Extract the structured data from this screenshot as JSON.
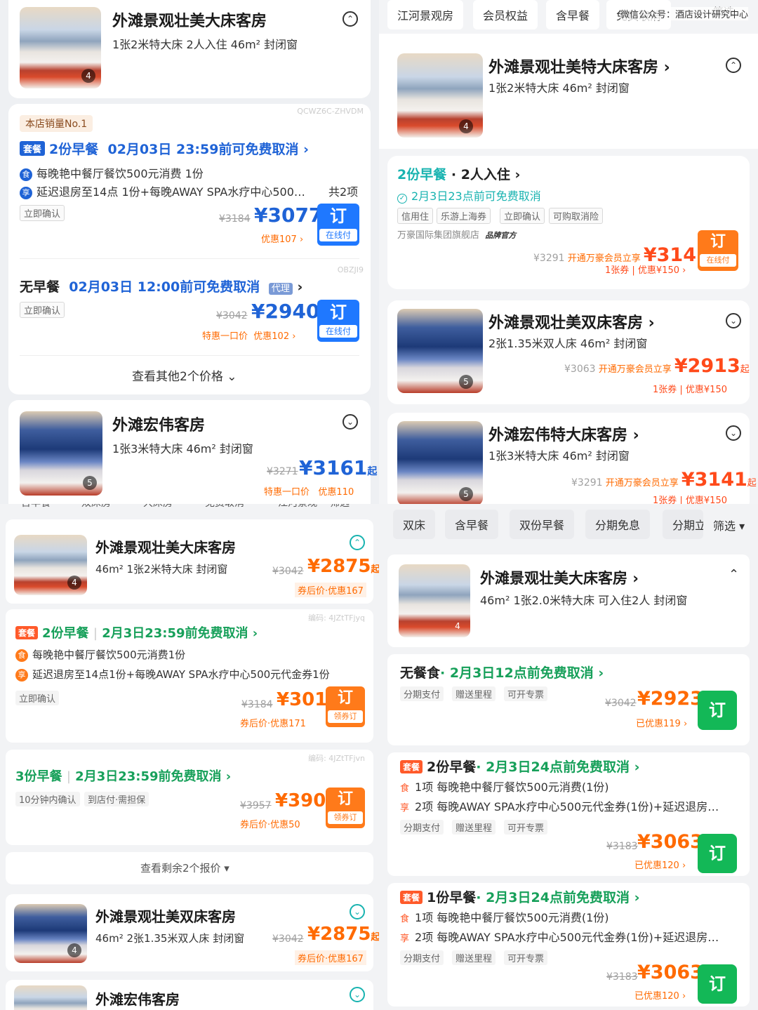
{
  "panel_a": {
    "room1": {
      "title": "外滩景观壮美大床客房",
      "sub": "1张2米特大床  2人入住  46m²  封闭窗",
      "count": "4"
    },
    "sales_badge": "本店销量No.1",
    "watermark1": "QCWZ6C-ZHVDM",
    "offer1": {
      "tag": "套餐",
      "title": "2份早餐",
      "cancel": "02月03日 23:59前可免费取消 ›",
      "perk1_icon": "食",
      "perk1": "每晚艳中餐厅餐饮500元消费 1份",
      "perk2_icon": "享",
      "perk2": "延迟退房至14点 1份+每晚AWAY SPA水疗中心500…",
      "perk_count": "共2项",
      "confirm": "立即确认",
      "old": "¥3184",
      "price": "¥3077",
      "discount": "优惠107 ›",
      "btn": "订",
      "btn_sub": "在线付"
    },
    "watermark2": "OBZJI9",
    "offer2": {
      "title": "无早餐",
      "cancel": "02月03日 12:00前可免费取消",
      "agent": "代理",
      "confirm": "立即确认",
      "old": "¥3042",
      "price": "¥2940",
      "discount1": "特惠一口价",
      "discount2": "优惠102 ›",
      "btn": "订",
      "btn_sub": "在线付"
    },
    "more": "查看其他2个价格 ⌄",
    "room2": {
      "title": "外滩宏伟客房",
      "sub": "1张3米特大床  46m²  封闭窗",
      "count": "5",
      "old": "¥3271",
      "price": "¥3161",
      "suffix": "起",
      "d1": "特惠一口价",
      "d2": "优惠110"
    }
  },
  "panel_b": {
    "filters": [
      "江河景观房",
      "会员权益",
      "含早餐",
      "免费取消",
      "筛选"
    ],
    "watermark": "微信公众号：酒店设计研究中心",
    "room1": {
      "title": "外滩景观壮美特大床客房 ›",
      "sub": "1张2米特大床  46m²  封闭窗",
      "count": "4"
    },
    "offer": {
      "title": "2份早餐",
      "people": "· 2人入住 ›",
      "cancel": "2月3日23点前可免费取消",
      "tags": [
        "信用住",
        "乐游上海券",
        "立即确认",
        "可购取消险"
      ],
      "seller": "万豪国际集团旗舰店",
      "seller_badge": "品牌官方",
      "old": "¥3291",
      "member": "开通万豪会员立享",
      "price": "¥3141",
      "coupon": "1张券 | 优惠¥150 ›",
      "btn": "订",
      "btn_sub": "在线付"
    },
    "room2": {
      "title": "外滩景观壮美双床客房 ›",
      "sub": "2张1.35米双人床  46m²  封闭窗",
      "count": "5",
      "old": "¥3063",
      "member": "开通万豪会员立享",
      "price": "¥2913",
      "suffix": "起",
      "coupon": "1张券 | 优惠¥150"
    },
    "room3": {
      "title": "外滩宏伟特大床客房 ›",
      "sub": "1张3米特大床  46m²  封闭窗",
      "count": "5",
      "old": "¥3291",
      "member": "开通万豪会员立享",
      "price": "¥3141",
      "suffix": "起",
      "coupon": "1张券 | 优惠¥150"
    }
  },
  "panel_c": {
    "filters": [
      "含早餐",
      "双床房",
      "大床房",
      "免费取消",
      "江河景观",
      "筛选"
    ],
    "room1": {
      "title": "外滩景观壮美大床客房",
      "sub": "46m²   1张2米特大床   封闭窗",
      "count": "4",
      "old": "¥3042",
      "price": "¥2875",
      "suffix": "起",
      "discount": "券后价·优惠167"
    },
    "watermark1": "编码: 4JZtTFjyq",
    "offer1": {
      "tag": "套餐",
      "title": "2份早餐",
      "cancel": "2月3日23:59前免费取消 ›",
      "perk1_icon": "食",
      "perk1": "每晚艳中餐厅餐饮500元消费1份",
      "perk2_icon": "享",
      "perk2": "延迟退房至14点1份+每晚AWAY SPA水疗中心500元代金券1份",
      "confirm": "立即确认",
      "old": "¥3184",
      "price": "¥3012",
      "discount": "券后价·优惠171",
      "btn": "订",
      "btn_sub": "领券订"
    },
    "watermark2": "编码: 4JZtTFjvn",
    "offer2": {
      "title": "3份早餐",
      "cancel": "2月3日23:59前免费取消 ›",
      "tag1": "10分钟内确认",
      "tag2": "到店付·需担保",
      "old": "¥3957",
      "price": "¥3907",
      "discount": "券后价·优惠50",
      "btn": "订",
      "btn_sub": "领券订"
    },
    "more": "查看剩余2个报价 ▾",
    "room2": {
      "title": "外滩景观壮美双床客房",
      "sub": "46m²   2张1.35米双人床   封闭窗",
      "count": "4",
      "old": "¥3042",
      "price": "¥2875",
      "suffix": "起",
      "discount": "券后价·优惠167"
    },
    "room3": {
      "title": "外滩宏伟客房"
    }
  },
  "panel_d": {
    "filters": [
      "双床",
      "含早餐",
      "双份早餐",
      "分期免息",
      "分期立",
      "筛选 ▾"
    ],
    "room1": {
      "title": "外滩景观壮美大床客房 ›",
      "sub": "46m² 1张2.0米特大床  可入住2人  封闭窗",
      "count": "4"
    },
    "offer1": {
      "title": "无餐食",
      "cancel": "· 2月3日12点前免费取消 ›",
      "tags": [
        "分期支付",
        "赠送里程",
        "可开专票"
      ],
      "old": "¥3042",
      "price": "¥2923",
      "discount": "已优惠119 ›",
      "btn": "订"
    },
    "offer2": {
      "tag": "套餐",
      "title": "2份早餐",
      "cancel": "· 2月3日24点前免费取消 ›",
      "perk1_icon": "食",
      "perk1": "1项 每晚艳中餐厅餐饮500元消费(1份)",
      "perk2_icon": "享",
      "perk2": "2项 每晚AWAY SPA水疗中心500元代金券(1份)+延迟退房…",
      "tags": [
        "分期支付",
        "赠送里程",
        "可开专票"
      ],
      "old": "¥3183",
      "price": "¥3063",
      "discount": "已优惠120 ›",
      "btn": "订"
    },
    "offer3": {
      "tag": "套餐",
      "title": "1份早餐",
      "cancel": "· 2月3日24点前免费取消 ›",
      "perk1_icon": "食",
      "perk1": "1项 每晚艳中餐厅餐饮500元消费(1份)",
      "perk2_icon": "享",
      "perk2": "2项 每晚AWAY SPA水疗中心500元代金券(1份)+延迟退房…",
      "tags": [
        "分期支付",
        "赠送里程",
        "可开专票"
      ],
      "old": "¥3183",
      "price": "¥3063",
      "discount": "已优惠120 ›",
      "btn": "订"
    }
  }
}
